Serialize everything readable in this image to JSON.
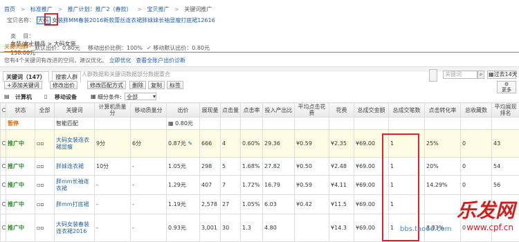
{
  "breadcrumb": {
    "items": [
      "首页",
      ">",
      "标准推广",
      ">",
      "推广计划：推广2（春款）",
      ">",
      "宝贝推广",
      ">",
      "关键词推广"
    ],
    "search_placeholder": "关键词"
  },
  "item": {
    "name_label": "宝贝名称：",
    "name_tag": "大码",
    "name_value": "女装胖MM春装2016新款蕾丝连衣裙胖妹妹长袖显瘦打底裙12616",
    "category_label": "类    目：",
    "category_value": "女装/女士精品 > 大码女装",
    "price_label": "价    格：",
    "price_value": "138.00元",
    "default_bid": "默认出价：0.80元",
    "mobile_ratio": "移动出价比例：100%",
    "mobile_default": "移动默认出价：0.80元"
  },
  "tabs": {
    "active": "关键词推广"
  },
  "tip": {
    "text": "您有4个关键词有改进的空间，建议优化。",
    "optimize_link": "立即优化",
    "diagnose_link": "查看全账户出价诊断"
  },
  "keyword_tabs": [
    {
      "label": "关键词（147）"
    },
    {
      "label": "搜索人群"
    }
  ],
  "extra_tab_text": "人群数据和关键词数据部分数据重合",
  "right_controls": {
    "period": "过去14天",
    "more": "更多"
  },
  "toolbar": {
    "add_keyword": "+添加关键词",
    "modify_bid": "修改出价",
    "modify_match": "修改匹配方式",
    "delete": "删除",
    "copy": "复制",
    "tag": "标签"
  },
  "toolbar2": {
    "computer": "计算机",
    "mobile": "移动设备",
    "filter_label": "细分条件:",
    "filter_value": "全部"
  },
  "table": {
    "headers": [
      "状态",
      "全部",
      "关键词",
      "计算机质量分",
      "移动质量分",
      "出价",
      "展现量",
      "点击量",
      "点击率",
      "投入产出比",
      "平均点击花费",
      "花费",
      "总成交金额",
      "总成交笔数",
      "点击转化率",
      "总收藏数",
      "平均展现排名"
    ],
    "rows": [
      {
        "status": "暂停",
        "keyword": "智能匹配",
        "pc_q": "",
        "m_q": "",
        "bid": "0.80元",
        "impr": "",
        "clicks": "",
        "ctr": "",
        "roi": "",
        "cpc": "",
        "cost": "",
        "gmv": "",
        "orders": "",
        "cvr": "",
        "fav": "",
        "rank": "",
        "status_on": false
      },
      {
        "status": "推广中",
        "keyword": "大码女装连衣裙显瘦",
        "pc_q": "9分",
        "m_q": "6分",
        "bid": "0.87元",
        "impr": "666",
        "clicks": "4",
        "ctr": "0.60%",
        "roi": "29.36",
        "cpc": "¥0.59",
        "cost": "¥2.35",
        "gmv": "¥69.00",
        "orders": "1",
        "cvr": "25%",
        "fav": "0",
        "rank": "43",
        "status_on": true
      },
      {
        "status": "推广中",
        "keyword": "胖妹连衣裙",
        "pc_q": "10分",
        "m_q": "-",
        "bid": "1.05元",
        "impr": "298",
        "clicks": "5",
        "ctr": "1.68%",
        "roi": "27.82",
        "cpc": "¥0.50",
        "cost": "¥2.48",
        "gmv": "¥69.00",
        "orders": "1",
        "cvr": "20%",
        "fav": "0",
        "rank": "54",
        "status_on": true
      },
      {
        "status": "推广中",
        "keyword": "胖mm长袖连衣裙",
        "pc_q": "-",
        "m_q": "-",
        "bid": "1.29元",
        "impr": "407",
        "clicks": "7",
        "ctr": "1.72%",
        "roi": "16.79",
        "cpc": "¥0.59",
        "cost": "¥4.11",
        "gmv": "¥69.00",
        "orders": "1",
        "cvr": "14.29%",
        "fav": "0",
        "rank": "56",
        "status_on": true
      },
      {
        "status": "推广中",
        "keyword": "胖mm打底裙",
        "pc_q": "-",
        "m_q": "-",
        "bid": "1.19元",
        "impr": "2,578",
        "clicks": "27",
        "ctr": "1.05%",
        "roi": "6.03",
        "cpc": "¥0.42",
        "cost": "¥11.5",
        "gmv": "¥69.00",
        "orders": "1",
        "cvr": "",
        "fav": "",
        "rank": "",
        "status_on": true
      },
      {
        "status": "推广中",
        "keyword": "大码女装春装连衣裙2016",
        "pc_q": "-",
        "m_q": "-",
        "bid": "0.93元",
        "impr": "3,001",
        "clicks": "30",
        "ctr": "1.3",
        "roi": "4.80",
        "cpc": "",
        "cost": "¥14.3",
        "gmv": "¥69.00",
        "orders": "1",
        "cvr": "3.33%",
        "fav": "0",
        "rank": "",
        "status_on": true
      }
    ]
  },
  "watermark": {
    "main": "乐发网",
    "url": "www.cpf.cn",
    "sub": "bbs.tao66.com"
  }
}
